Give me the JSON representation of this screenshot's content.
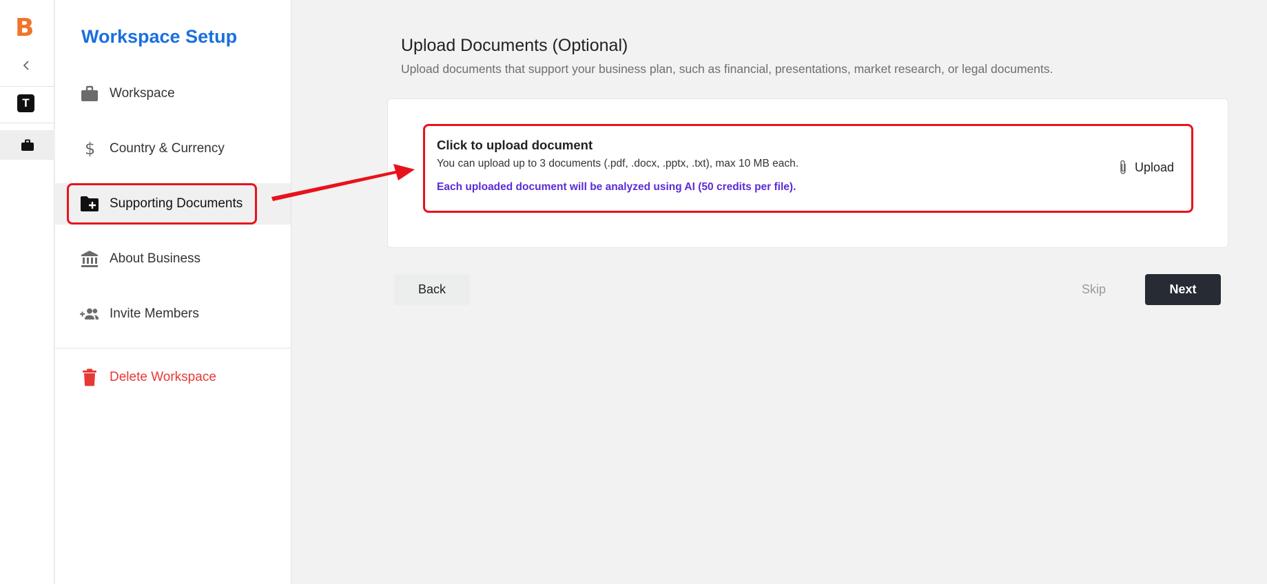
{
  "app": {
    "logo_letter": "B"
  },
  "rail": {
    "workspace_initial": "T"
  },
  "sidebar": {
    "title": "Workspace Setup",
    "items": [
      {
        "label": "Workspace",
        "icon": "briefcase-icon"
      },
      {
        "label": "Country & Currency",
        "icon": "dollar-icon"
      },
      {
        "label": "Supporting Documents",
        "icon": "folder-plus-icon",
        "active": true
      },
      {
        "label": "About Business",
        "icon": "bank-icon"
      },
      {
        "label": "Invite Members",
        "icon": "add-group-icon"
      }
    ],
    "danger_item": {
      "label": "Delete Workspace",
      "icon": "trash-icon"
    }
  },
  "main": {
    "title": "Upload Documents (Optional)",
    "subtitle": "Upload documents that support your business plan, such as financial, presentations, market research, or legal documents.",
    "upload": {
      "title": "Click to upload document",
      "limit_text": "You can upload up to 3 documents (.pdf, .docx, .pptx, .txt), max 10 MB each.",
      "ai_note": "Each uploaded document will be analyzed using AI (50 credits per file).",
      "button_label": "Upload"
    },
    "actions": {
      "back_label": "Back",
      "skip_label": "Skip",
      "next_label": "Next"
    }
  },
  "colors": {
    "brand_orange": "#f0742a",
    "title_blue": "#1a6fe0",
    "ai_purple": "#5b2bd6",
    "danger_red": "#e53935",
    "annotation_red": "#e8121c",
    "next_button": "#262b34"
  }
}
